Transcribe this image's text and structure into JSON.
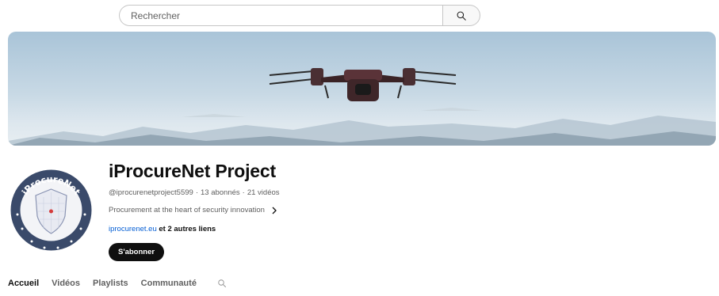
{
  "search": {
    "placeholder": "Rechercher",
    "icon": "search-icon"
  },
  "banner": {
    "image": "drone-over-mountains"
  },
  "channel": {
    "name": "iProcureNet Project",
    "handle": "@iprocurenetproject5599",
    "subscribers": "13 abonnés",
    "videos": "21 vidéos",
    "separator": "·",
    "description": "Procurement at the heart of security innovation",
    "link_text": "iprocurenet.eu",
    "more_links": "et 2 autres liens",
    "subscribe_label": "S'abonner",
    "avatar_text": "iProcureNet"
  },
  "tabs": [
    {
      "label": "Accueil",
      "active": true
    },
    {
      "label": "Vidéos",
      "active": false
    },
    {
      "label": "Playlists",
      "active": false
    },
    {
      "label": "Communauté",
      "active": false
    }
  ],
  "colors": {
    "link": "#065fd4",
    "subscribe_bg": "#0f0f0f",
    "avatar_ring": "#3a4a6a"
  }
}
